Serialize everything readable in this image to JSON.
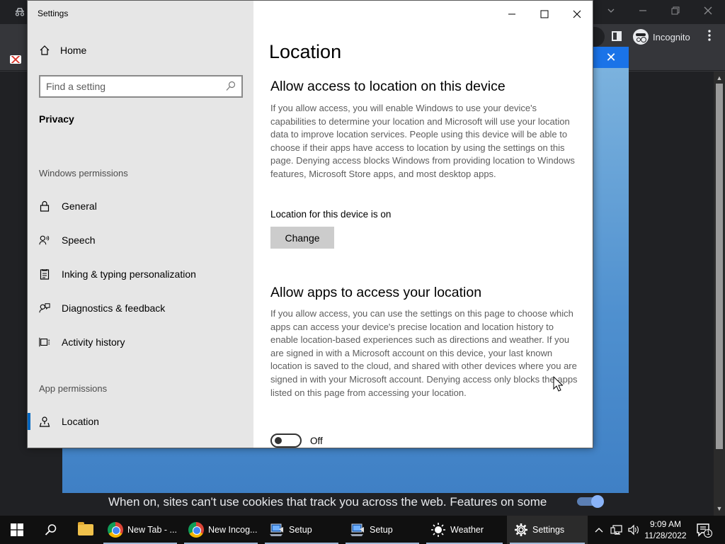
{
  "browser": {
    "incognito_label": "Incognito",
    "cookie_notice": "When on, sites can't use cookies that track you across the web. Features on some"
  },
  "settings": {
    "app_title": "Settings",
    "nav": {
      "home_label": "Home",
      "search_placeholder": "Find a setting",
      "privacy_heading": "Privacy",
      "windows_permissions_label": "Windows permissions",
      "windows_items": [
        {
          "label": "General",
          "icon": "lock-icon"
        },
        {
          "label": "Speech",
          "icon": "speech-icon"
        },
        {
          "label": "Inking & typing personalization",
          "icon": "inking-icon"
        },
        {
          "label": "Diagnostics & feedback",
          "icon": "feedback-icon"
        },
        {
          "label": "Activity history",
          "icon": "activity-history-icon"
        }
      ],
      "app_permissions_label": "App permissions",
      "app_items": [
        {
          "label": "Location",
          "icon": "location-icon",
          "selected": true
        }
      ]
    },
    "main": {
      "title": "Location",
      "device_heading": "Allow access to location on this device",
      "device_description": "If you allow access, you will enable Windows to use your device's capabilities to determine your location and Microsoft will use your location data to improve location services. People using this device will be able to choose if their apps have access to location by using the settings on this page. Denying access blocks Windows from providing location to Windows features, Microsoft Store apps, and most desktop apps.",
      "device_status": "Location for this device is on",
      "change_button": "Change",
      "apps_heading": "Allow apps to access your location",
      "apps_description": "If you allow access, you can use the settings on this page to choose which apps can access your device's precise location and location history to enable location-based experiences such as directions and weather. If you are signed in with a Microsoft account on this device, your last known location is saved to the cloud, and shared with other devices where you are signed in with your Microsoft account. Denying access only blocks the apps listed on this page from accessing your location.",
      "apps_toggle_label": "Off",
      "apps_toggle_on": false
    }
  },
  "taskbar": {
    "apps": [
      {
        "label": "New Tab - ...",
        "icon": "chrome-icon"
      },
      {
        "label": "New Incog...",
        "icon": "chrome-icon"
      },
      {
        "label": "Setup",
        "icon": "setup-icon"
      },
      {
        "label": "Setup",
        "icon": "setup-icon"
      },
      {
        "label": "Weather",
        "icon": "weather-icon"
      },
      {
        "label": "Settings",
        "icon": "gear-icon",
        "active": true
      }
    ],
    "time": "9:09 AM",
    "date": "11/28/2022",
    "notification_count": "1"
  },
  "colors": {
    "accent": "#0067c0",
    "nav_background": "#e6e6e6",
    "taskbar": "#101010"
  }
}
